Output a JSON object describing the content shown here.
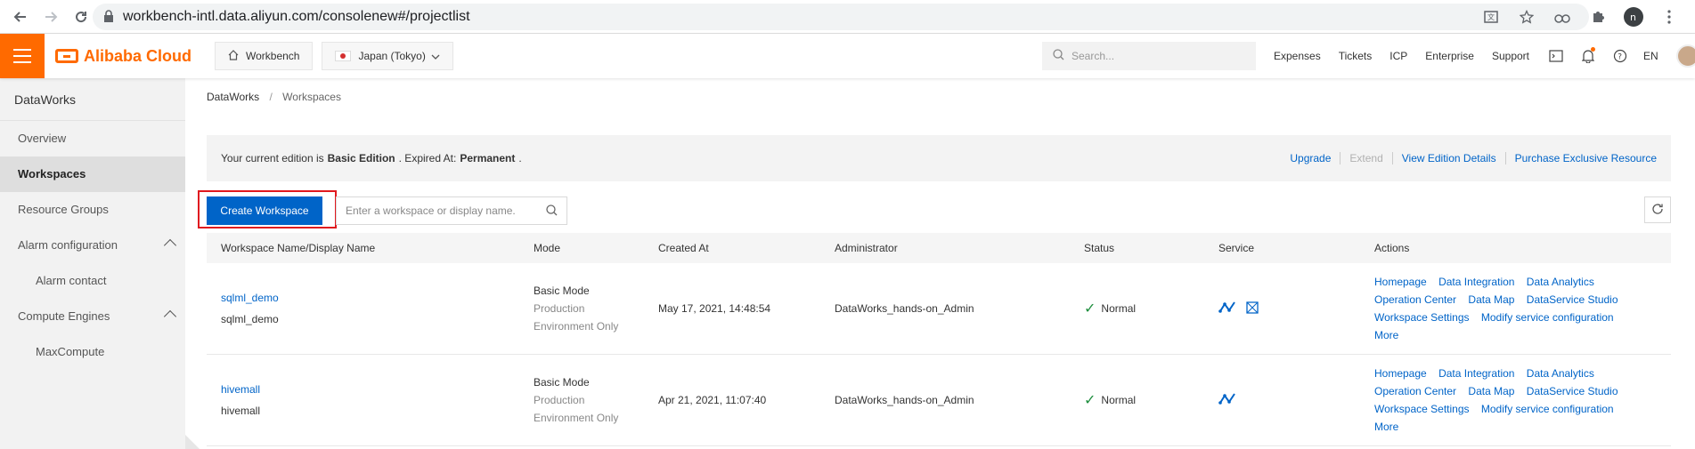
{
  "browser": {
    "url": "workbench-intl.data.aliyun.com/consolenew#/projectlist"
  },
  "topbar": {
    "brand": "Alibaba Cloud",
    "workbench_label": "Workbench",
    "region_label": "Japan (Tokyo)",
    "search_placeholder": "Search...",
    "links": [
      "Expenses",
      "Tickets",
      "ICP",
      "Enterprise",
      "Support"
    ],
    "lang": "EN",
    "accent_color": "#ff6a00"
  },
  "sidebar": {
    "title": "DataWorks",
    "items": [
      {
        "label": "Overview"
      },
      {
        "label": "Workspaces"
      },
      {
        "label": "Resource Groups"
      },
      {
        "label": "Alarm configuration"
      },
      {
        "label": "Alarm contact"
      },
      {
        "label": "Compute Engines"
      },
      {
        "label": "MaxCompute"
      }
    ]
  },
  "breadcrumb": {
    "root": "DataWorks",
    "sep": "/",
    "current": "Workspaces"
  },
  "edition": {
    "prefix": "Your current edition is",
    "edition_name": "Basic Edition",
    "expired_label": ". Expired At:",
    "expired_value": "Permanent",
    "suffix": ".",
    "links": [
      "Upgrade",
      "Extend",
      "View Edition Details",
      "Purchase Exclusive Resource"
    ]
  },
  "toolbar": {
    "create_label": "Create Workspace",
    "search_placeholder": "Enter a workspace or display name."
  },
  "table": {
    "headers": [
      "Workspace Name/Display Name",
      "Mode",
      "Created At",
      "Administrator",
      "Status",
      "Service",
      "Actions"
    ],
    "rows": [
      {
        "name": "sqlml_demo",
        "display": "sqlml_demo",
        "mode1": "Basic Mode",
        "mode2": "Production",
        "mode3": "Environment Only",
        "created": "May 17, 2021, 14:48:54",
        "admin": "DataWorks_hands-on_Admin",
        "status": "Normal"
      },
      {
        "name": "hivemall",
        "display": "hivemall",
        "mode1": "Basic Mode",
        "mode2": "Production",
        "mode3": "Environment Only",
        "created": "Apr 21, 2021, 11:07:40",
        "admin": "DataWorks_hands-on_Admin",
        "status": "Normal"
      }
    ],
    "actions": [
      "Homepage",
      "Data Integration",
      "Data Analytics",
      "Operation Center",
      "Data Map",
      "DataService Studio",
      "Workspace Settings",
      "Modify service configuration",
      "More"
    ]
  }
}
